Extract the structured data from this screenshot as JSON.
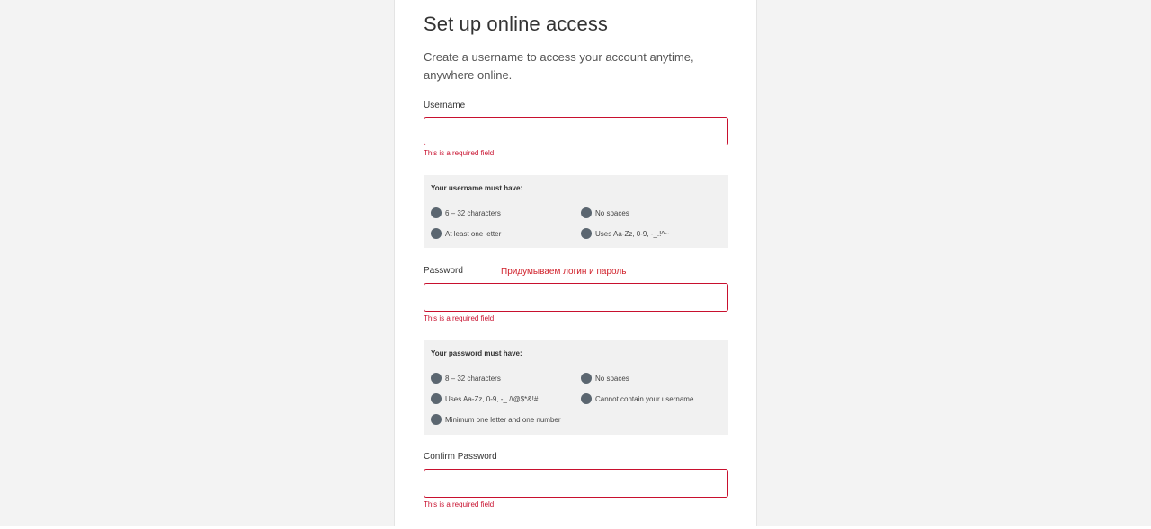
{
  "form": {
    "title": "Set up online access",
    "subtitle": "Create a username to access your account anytime, anywhere online.",
    "username": {
      "label": "Username",
      "value": "",
      "error": "This is a required field"
    },
    "username_rules": {
      "title": "Your username must have:",
      "items": [
        "6 – 32 characters",
        "No spaces",
        "At least one letter",
        "Uses Aa-Zz, 0-9, -_.!^~"
      ]
    },
    "password": {
      "label": "Password",
      "value": "",
      "error": "This is a required field"
    },
    "annotation": "Придумываем логин и пароль",
    "password_rules": {
      "title": "Your password must have:",
      "items": [
        "8 – 32 characters",
        "No spaces",
        "Uses Aa-Zz, 0-9, -_./\\@$*&!#",
        "Cannot contain your username",
        "Minimum one letter and one number"
      ]
    },
    "confirm_password": {
      "label": "Confirm Password",
      "value": "",
      "error": "This is a required field"
    }
  },
  "colors": {
    "error": "#c8102e",
    "rule_dot": "#5b6670",
    "rules_bg": "#f1f1f1",
    "page_bg": "#f3f3f3"
  },
  "icons": {
    "rule_indicator": "circle-icon"
  }
}
